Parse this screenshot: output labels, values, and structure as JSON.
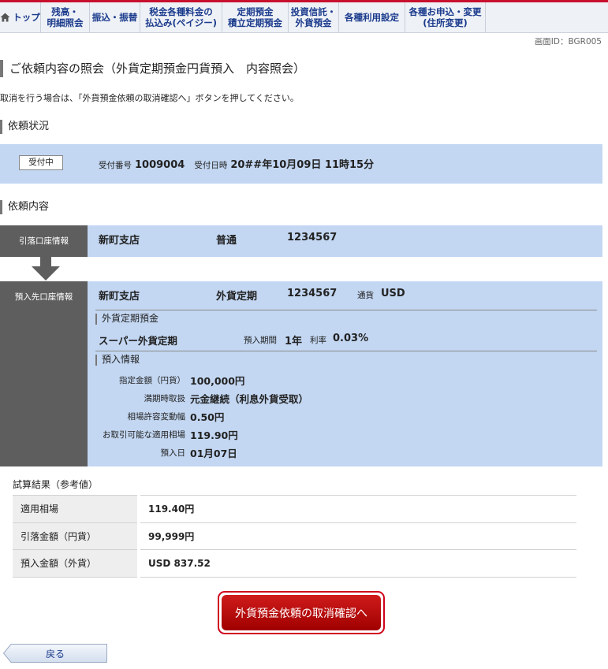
{
  "nav": [
    {
      "label": "トップ",
      "icon": "home-icon"
    },
    {
      "label": "残高・\n明細照会"
    },
    {
      "label": "振込・振替"
    },
    {
      "label": "税金各種料金の\n払込み(ペイジー)"
    },
    {
      "label": "定期預金\n積立定期預金"
    },
    {
      "label": "投資信託・\n外貨預金"
    },
    {
      "label": "各種利用設定"
    },
    {
      "label": "各種お申込・変更\n(住所変更)"
    }
  ],
  "screen_id": "画面ID：BGR005",
  "page_title": "ご依頼内容の照会（外貨定期預金円貨預入　内容照会）",
  "notice": "取消を行う場合は、「外貨預金依頼の取消確認へ」ボタンを押してください。",
  "status_section": {
    "heading": "依頼状況",
    "status_badge": "受付中",
    "receipt_no_label": "受付番号",
    "receipt_no": "1009004",
    "receipt_date_label": "受付日時",
    "receipt_date": "20##年10月09日 11時15分"
  },
  "detail_section": {
    "heading": "依頼内容",
    "debit": {
      "label": "引落口座情報",
      "branch": "新町支店",
      "type": "普通",
      "number": "1234567"
    },
    "deposit": {
      "label": "預入先口座情報",
      "branch": "新町支店",
      "type": "外貨定期",
      "number": "1234567",
      "currency_label": "通貨",
      "currency": "USD"
    },
    "product": {
      "heading": "外貨定期預金",
      "name": "スーパー外貨定期",
      "term_label": "預入期間",
      "term": "1年",
      "rate_label": "利率",
      "rate": "0.03%"
    },
    "deposit_info": {
      "heading": "預入情報",
      "items": [
        {
          "label": "指定金額（円貨）",
          "value": "100,000円"
        },
        {
          "label": "満期時取扱",
          "value": "元金継続（利息外貨受取）"
        },
        {
          "label": "相場許容変動幅",
          "value": "0.50円"
        },
        {
          "label": "お取引可能な適用相場",
          "value": "119.90円"
        },
        {
          "label": "預入日",
          "value": "01月07日"
        }
      ]
    }
  },
  "trial": {
    "title": "試算結果（参考値）",
    "rows": [
      {
        "label": "適用相場",
        "value": "119.40円"
      },
      {
        "label": "引落金額（円貨）",
        "value": "99,999円"
      },
      {
        "label": "預入金額（外貨）",
        "value": "USD 837.52"
      }
    ]
  },
  "cancel_button": "外貨預金依頼の取消確認へ",
  "back_button": "戻る",
  "colors": {
    "accent_red": "#c8102e",
    "nav_text": "#1a3a8c",
    "band_blue": "#c3d7f2",
    "label_gray": "#5e5e5e"
  }
}
